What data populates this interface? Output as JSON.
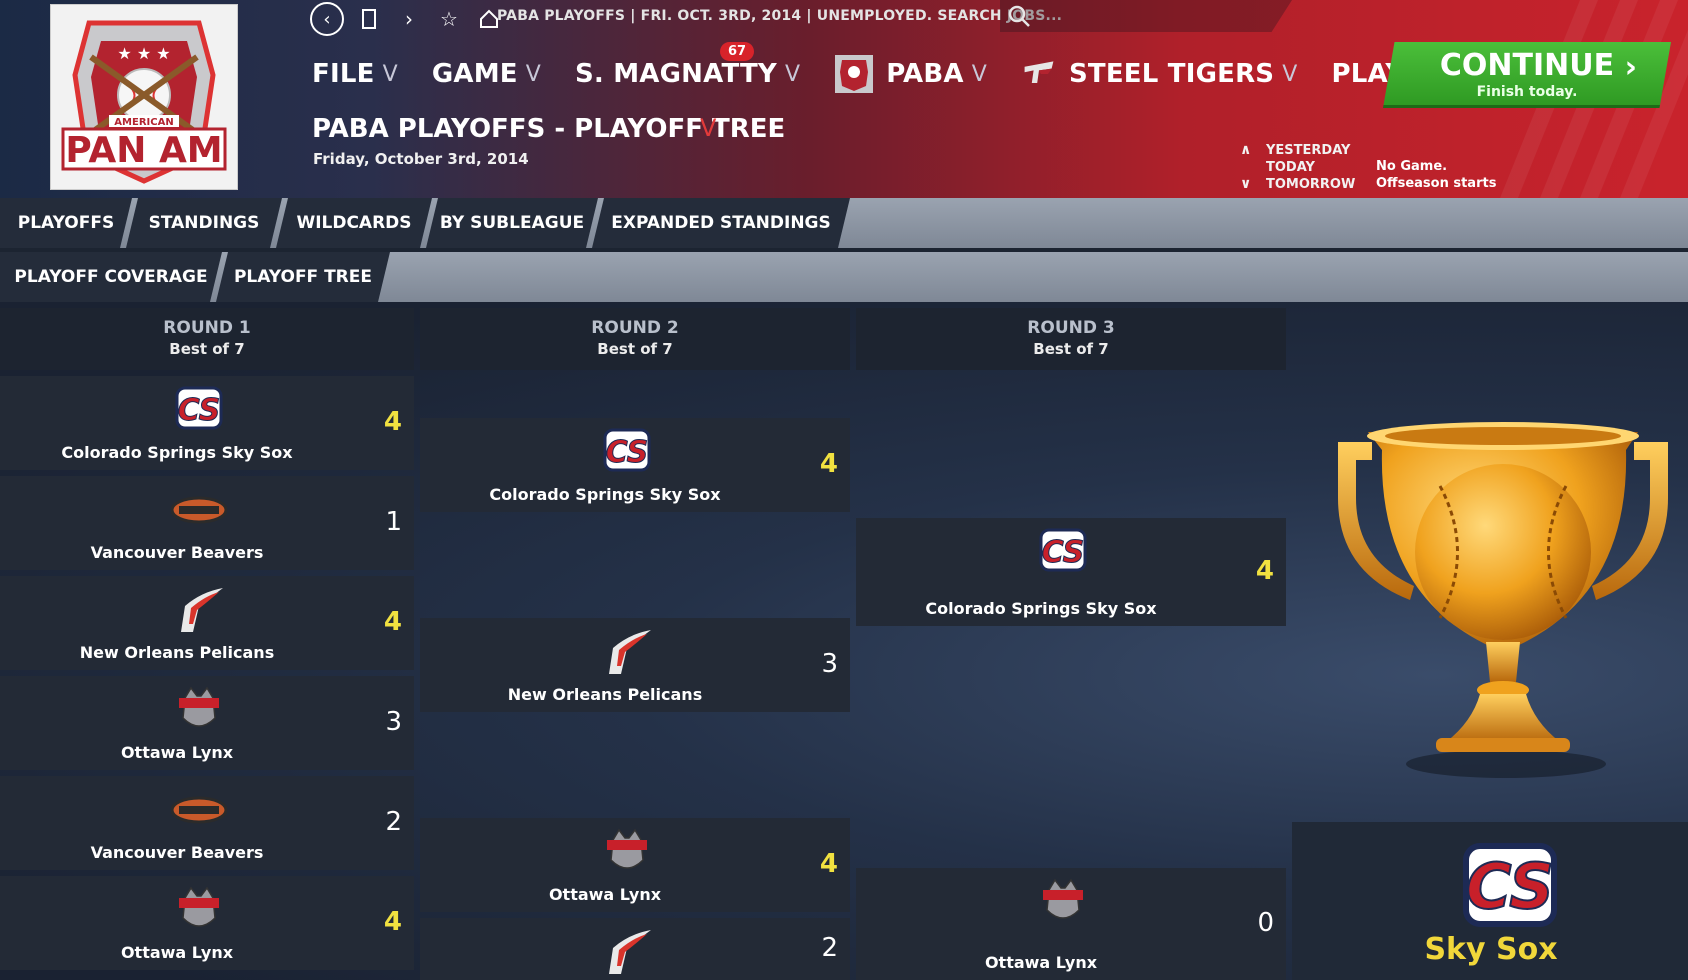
{
  "header": {
    "crumb": "PABA PLAYOFFS  |  FRI. OCT. 3RD, 2014  |  UNEMPLOYED. SEARCH JOBS...",
    "menu": {
      "file": "FILE",
      "game": "GAME",
      "manager": "S. MAGNATTY",
      "manager_badge": "67",
      "league": "PABA",
      "team": "STEEL TIGERS",
      "play": "PLAY"
    },
    "continue": {
      "label": "CONTINUE",
      "sub": "Finish today."
    },
    "page_title": "PABA PLAYOFFS - PLAYOFF TREE",
    "page_date": "Friday, October 3rd, 2014",
    "daynav": {
      "yesterday": "YESTERDAY",
      "today": "TODAY",
      "tomorrow": "TOMORROW",
      "info_line1": "No Game.",
      "info_line2": "Offseason starts"
    },
    "logo_text": "PAN AM",
    "logo_sub": "AMERICAN"
  },
  "tabs_primary": [
    "PLAYOFFS",
    "STANDINGS",
    "WILDCARDS",
    "BY SUBLEAGUE",
    "EXPANDED STANDINGS"
  ],
  "tabs_secondary": [
    "PLAYOFF COVERAGE",
    "PLAYOFF TREE"
  ],
  "rounds": [
    {
      "name": "ROUND 1",
      "format": "Best of 7"
    },
    {
      "name": "ROUND 2",
      "format": "Best of 7"
    },
    {
      "name": "ROUND 3",
      "format": "Best of 7"
    }
  ],
  "round1": [
    {
      "team": "Colorado Springs Sky Sox",
      "score": "4",
      "winner": true,
      "logo": "skysox"
    },
    {
      "team": "Vancouver Beavers",
      "score": "1",
      "winner": false,
      "logo": "beavers"
    },
    {
      "team": "New Orleans Pelicans",
      "score": "4",
      "winner": true,
      "logo": "pelicans"
    },
    {
      "team": "Ottawa Lynx",
      "score": "3",
      "winner": false,
      "logo": "lynx"
    },
    {
      "team": "Vancouver Beavers",
      "score": "2",
      "winner": false,
      "logo": "beavers"
    },
    {
      "team": "Ottawa Lynx",
      "score": "4",
      "winner": true,
      "logo": "lynx"
    }
  ],
  "round2": [
    {
      "team": "Colorado Springs Sky Sox",
      "score": "4",
      "winner": true,
      "logo": "skysox"
    },
    {
      "team": "New Orleans Pelicans",
      "score": "3",
      "winner": false,
      "logo": "pelicans"
    },
    {
      "team": "Ottawa Lynx",
      "score": "4",
      "winner": true,
      "logo": "lynx"
    },
    {
      "team": "",
      "score": "2",
      "winner": false,
      "logo": "pelicans"
    }
  ],
  "round3": [
    {
      "team": "Colorado Springs Sky Sox",
      "score": "4",
      "winner": true,
      "logo": "skysox"
    },
    {
      "team": "Ottawa Lynx",
      "score": "0",
      "winner": false,
      "logo": "lynx"
    }
  ],
  "champion": {
    "name": "Sky Sox",
    "logo": "skysox"
  },
  "colors": {
    "winner_score": "#f1e140",
    "continue_green": "#3aae2c",
    "badge_red": "#d8232a",
    "champion_gold": "#f1d73a"
  }
}
